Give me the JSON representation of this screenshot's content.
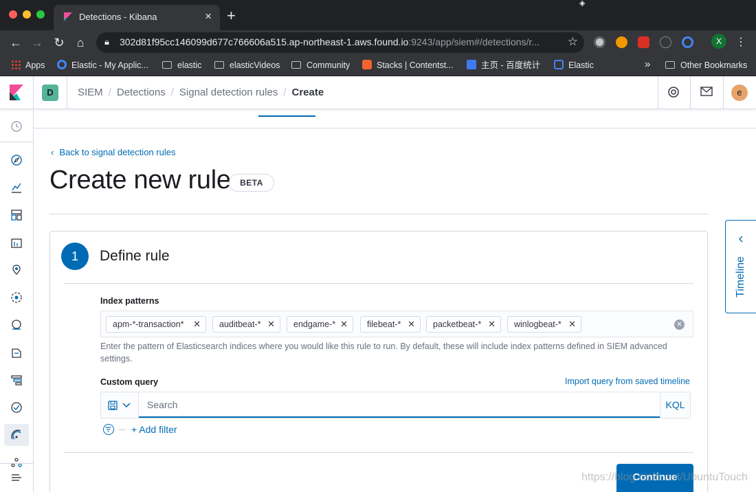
{
  "browser": {
    "tab_title": "Detections - Kibana",
    "tab_close": "×",
    "new_tab": "+",
    "url_main": "302d81f95cc146099d677c766606a515.ap-northeast-1.aws.found.io",
    "url_rest": ":9243/app/siem#/detections/r...",
    "profile_initial": "X",
    "bookmarks": [
      {
        "label": "Apps"
      },
      {
        "label": "Elastic - My Applic..."
      },
      {
        "label": "elastic"
      },
      {
        "label": "elasticVideos"
      },
      {
        "label": "Community"
      },
      {
        "label": "Stacks | Contentst..."
      },
      {
        "label": "主页 - 百度统计"
      },
      {
        "label": "Elastic"
      }
    ],
    "bookmarks_overflow": "»",
    "other_bookmarks": "Other Bookmarks"
  },
  "kibana": {
    "space_initial": "D",
    "avatar_initial": "e",
    "breadcrumbs": [
      "SIEM",
      "Detections",
      "Signal detection rules",
      "Create"
    ],
    "breadcrumb_sep": "/"
  },
  "page": {
    "back_link": "Back to signal detection rules",
    "title": "Create new rule",
    "badge": "BETA",
    "step_number": "1",
    "step_title": "Define rule",
    "index_label": "Index patterns",
    "index_patterns": [
      "apm-*-transaction*",
      "auditbeat-*",
      "endgame-*",
      "filebeat-*",
      "packetbeat-*",
      "winlogbeat-*"
    ],
    "index_help": "Enter the pattern of Elasticsearch indices where you would like this rule to run. By default, these will include index patterns defined in SIEM advanced settings.",
    "query_label": "Custom query",
    "import_link": "Import query from saved timeline",
    "search_placeholder": "Search",
    "kql": "KQL",
    "add_filter": "+ Add filter",
    "continue": "Continue",
    "timeline": "Timeline",
    "watermark": "https://blog.csdn.net/UbuntuTouch"
  },
  "colors": {
    "accent": "#006bb4",
    "space_badge": "#54b399",
    "avatar": "#e7a36a"
  }
}
